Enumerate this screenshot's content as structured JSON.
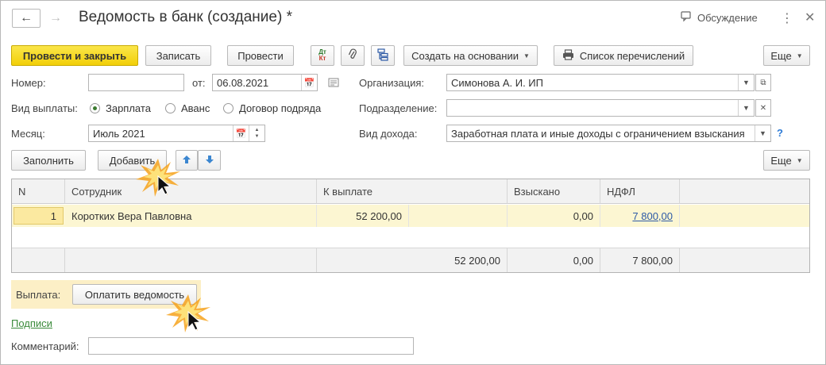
{
  "window": {
    "title": "Ведомость в банк (создание) *",
    "discussion_label": "Обсуждение"
  },
  "toolbar": {
    "post_close": "Провести и закрыть",
    "save": "Записать",
    "post": "Провести",
    "create_based_on": "Создать на основании",
    "transfer_list": "Список перечислений",
    "more": "Еще"
  },
  "form": {
    "number_label": "Номер:",
    "number_value": "",
    "from_label": "от:",
    "date_value": "06.08.2021",
    "org_label": "Организация:",
    "org_value": "Симонова А. И. ИП",
    "payment_type_label": "Вид выплаты:",
    "payment_options": [
      "Зарплата",
      "Аванс",
      "Договор подряда"
    ],
    "payment_selected": "Зарплата",
    "division_label": "Подразделение:",
    "division_value": "",
    "month_label": "Месяц:",
    "month_value": "Июль 2021",
    "income_type_label": "Вид дохода:",
    "income_type_value": "Заработная плата и иные доходы с ограничением взыскания",
    "help": "?"
  },
  "table_toolbar": {
    "fill": "Заполнить",
    "add": "Добавить",
    "more": "Еще"
  },
  "table": {
    "headers": [
      "N",
      "Сотрудник",
      "К выплате",
      "Взыскано",
      "НДФЛ"
    ],
    "rows": [
      {
        "n": "1",
        "employee": "Коротких Вера Павловна",
        "to_pay": "52 200,00",
        "collected": "0,00",
        "ndfl": "7 800,00"
      }
    ],
    "totals": {
      "to_pay": "52 200,00",
      "collected": "0,00",
      "ndfl": "7 800,00"
    }
  },
  "payment": {
    "label": "Выплата:",
    "pay_button": "Оплатить ведомость"
  },
  "signatures_link": "Подписи",
  "comment_label": "Комментарий:",
  "comment_value": "",
  "colors": {
    "primary": "#f5d000",
    "selected_row": "#fcf6d2",
    "link": "#2d5aa6",
    "green_link": "#3a8a3a"
  }
}
